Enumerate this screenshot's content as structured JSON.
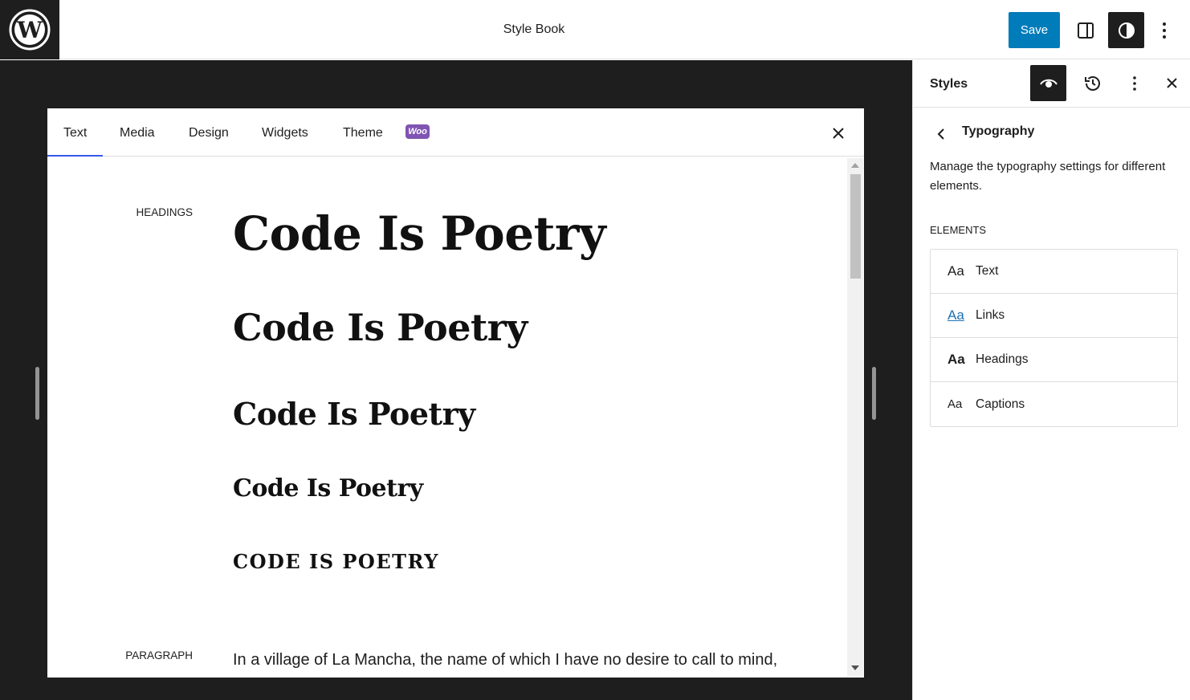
{
  "header": {
    "title": "Style Book",
    "save_label": "Save"
  },
  "stylebook": {
    "tabs": [
      {
        "label": "Text"
      },
      {
        "label": "Media"
      },
      {
        "label": "Design"
      },
      {
        "label": "Widgets"
      },
      {
        "label": "Theme"
      }
    ],
    "woo_label": "Woo",
    "headings_label": "Headings",
    "headings": [
      "Code Is Poetry",
      "Code Is Poetry",
      "Code Is Poetry",
      "Code Is Poetry",
      "CODE IS POETRY"
    ],
    "paragraph_label": "Paragraph",
    "paragraph_text": "In a village of La Mancha, the name of which I have no desire to call to mind,"
  },
  "sidebar": {
    "title": "Styles",
    "panel_title": "Typography",
    "panel_description": "Manage the typography settings for different elements.",
    "elements_label": "Elements",
    "elements": [
      {
        "sample": "Aa",
        "label": "Text"
      },
      {
        "sample": "Aa",
        "label": "Links"
      },
      {
        "sample": "Aa",
        "label": "Headings"
      },
      {
        "sample": "Aa",
        "label": "Captions"
      }
    ]
  },
  "colors": {
    "accent": "#007cba",
    "tab_indicator": "#3858e9",
    "woo": "#7f54b3",
    "canvas": "#1e1e1e"
  }
}
